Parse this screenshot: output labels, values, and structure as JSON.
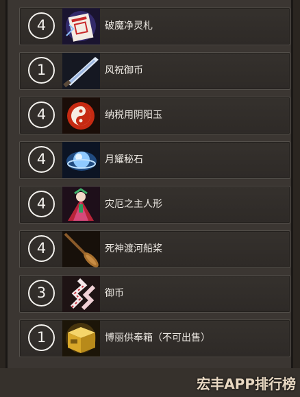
{
  "items": [
    {
      "count": "4",
      "name": "破魔净灵札",
      "icon": "talisman-icon"
    },
    {
      "count": "1",
      "name": "风祝御币",
      "icon": "gohei-blade-icon"
    },
    {
      "count": "4",
      "name": "纳税用阴阳玉",
      "icon": "yin-yang-orb-icon"
    },
    {
      "count": "4",
      "name": "月耀秘石",
      "icon": "moon-stone-icon"
    },
    {
      "count": "4",
      "name": "灾厄之主人形",
      "icon": "doll-icon"
    },
    {
      "count": "4",
      "name": "死神渡河船桨",
      "icon": "oar-icon"
    },
    {
      "count": "3",
      "name": "御币",
      "icon": "gohei-icon"
    },
    {
      "count": "1",
      "name": "博丽供奉箱（不可出售）",
      "icon": "offering-box-icon"
    }
  ],
  "watermark": "宏丰APP排行榜",
  "colors": {
    "panel": "#3b3632",
    "row": "#35312d",
    "text": "#eeeae4",
    "box": "#e0b83a"
  }
}
